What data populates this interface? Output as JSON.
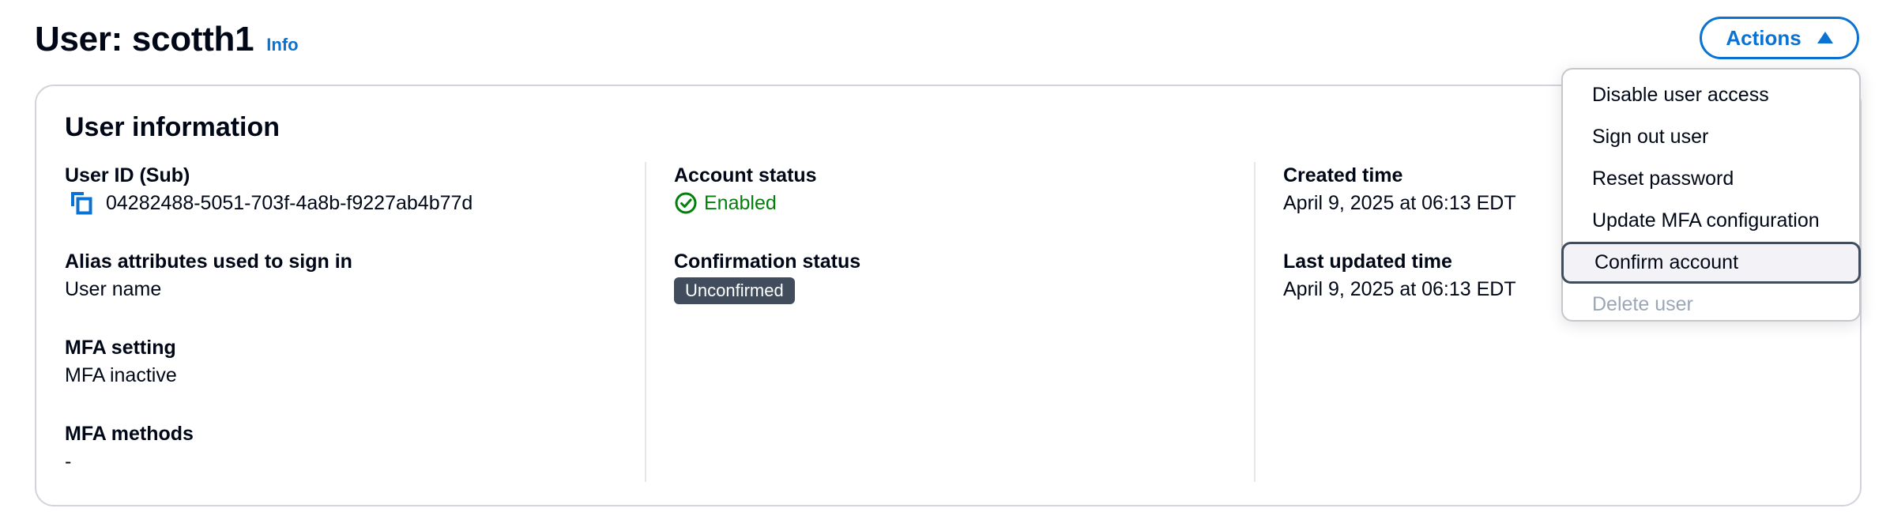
{
  "header": {
    "title": "User: scotth1",
    "info_label": "Info",
    "actions_label": "Actions"
  },
  "panel": {
    "title": "User information",
    "columns": [
      {
        "fields": [
          {
            "label": "User ID (Sub)",
            "value": "04282488-5051-703f-4a8b-f9227ab4b77d"
          },
          {
            "label": "Alias attributes used to sign in",
            "value": "User name"
          },
          {
            "label": "MFA setting",
            "value": "MFA inactive"
          },
          {
            "label": "MFA methods",
            "value": "-"
          }
        ]
      },
      {
        "fields": [
          {
            "label": "Account status",
            "value": "Enabled"
          },
          {
            "label": "Confirmation status",
            "value": "Unconfirmed"
          }
        ]
      },
      {
        "fields": [
          {
            "label": "Created time",
            "value": "April 9, 2025 at 06:13 EDT"
          },
          {
            "label": "Last updated time",
            "value": "April 9, 2025 at 06:13 EDT"
          }
        ]
      }
    ]
  },
  "actions_menu": {
    "items": [
      {
        "label": "Disable user access",
        "state": "normal"
      },
      {
        "label": "Sign out user",
        "state": "normal"
      },
      {
        "label": "Reset password",
        "state": "normal"
      },
      {
        "label": "Update MFA configuration",
        "state": "normal"
      },
      {
        "label": "Confirm account",
        "state": "highlighted"
      },
      {
        "label": "Delete user",
        "state": "disabled"
      }
    ]
  },
  "icons": {
    "copy": "copy-icon",
    "status_enabled": "check-circle-icon",
    "actions_caret": "caret-up-icon"
  },
  "colors": {
    "accent": "#0972d3",
    "success": "#037f0c",
    "badge_bg": "#414d5c",
    "disabled_text": "#9ba7b6"
  }
}
